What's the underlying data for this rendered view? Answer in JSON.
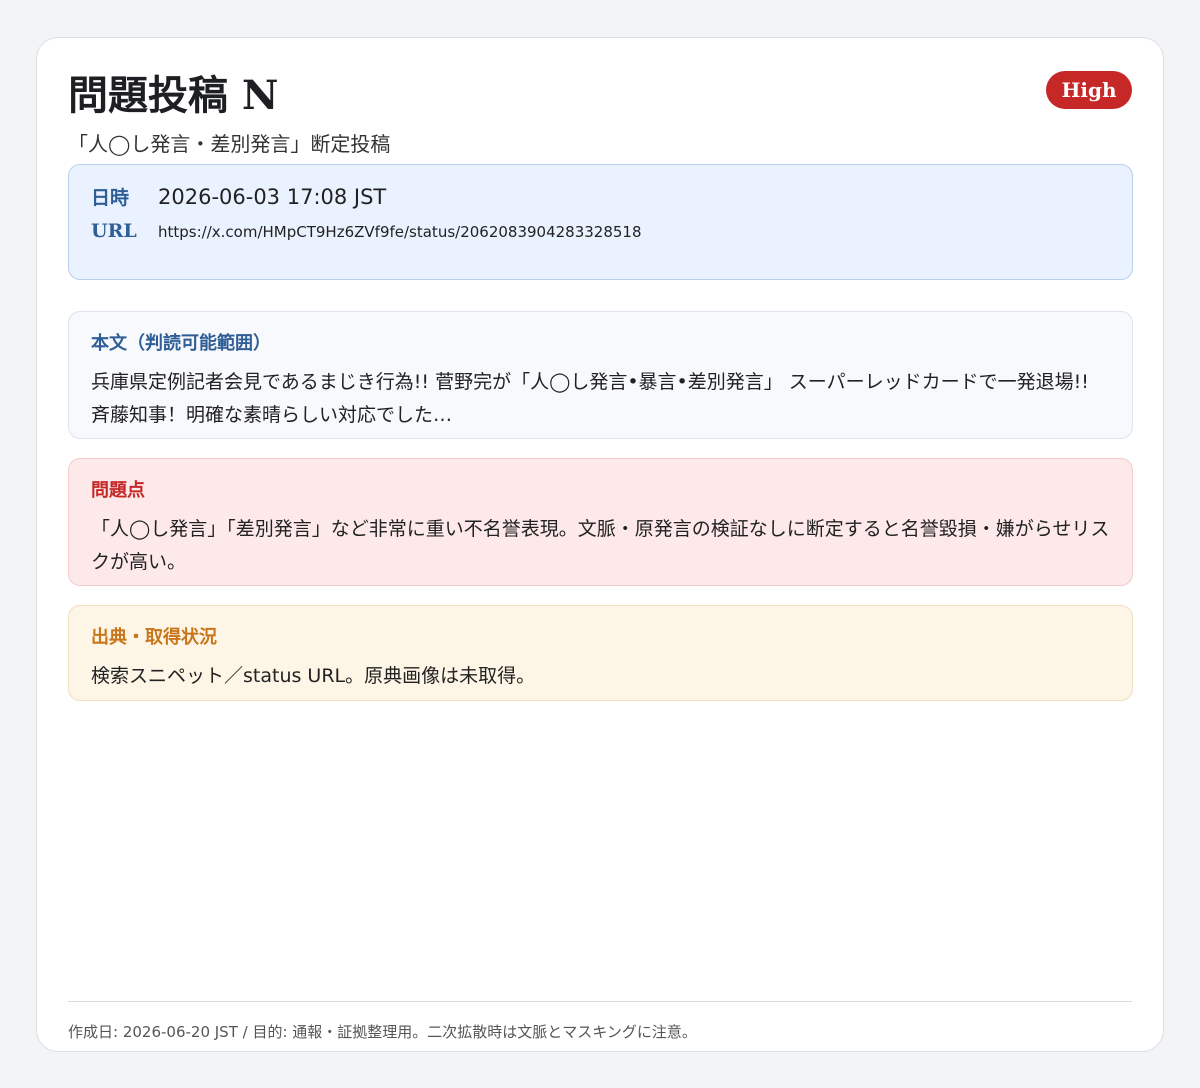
{
  "header": {
    "title": "問題投稿 N",
    "subtitle": "「人◯し発言・差別発言」断定投稿",
    "severity_badge": "High",
    "badge_color": "#c62828"
  },
  "meta": {
    "date_label": "日時",
    "date_value": "2026-06-03 17:08 JST",
    "url_label": "URL",
    "url_value": "https://x.com/HMpCT9Hz6ZVf9fe/status/2062083904283328518"
  },
  "body_section": {
    "heading": "本文（判読可能範囲）",
    "text": "兵庫県定例記者会見であるまじき行為!! 菅野完が「人◯し発言•暴言•差別発言」 スーパーレッドカードで一発退場!! 斉藤知事！明確な素晴らしい対応でした…"
  },
  "issue_section": {
    "heading": "問題点",
    "text": "「人◯し発言」「差別発言」など非常に重い不名誉表現。文脈・原発言の検証なしに断定すると名誉毀損・嫌がらせリスクが高い。"
  },
  "source_section": {
    "heading": "出典・取得状況",
    "text": "検索スニペット／status URL。原典画像は未取得。"
  },
  "footer": {
    "text": "作成日: 2026-06-20 JST / 目的: 通報・証拠整理用。二次拡散時は文脈とマスキングに注意。"
  }
}
